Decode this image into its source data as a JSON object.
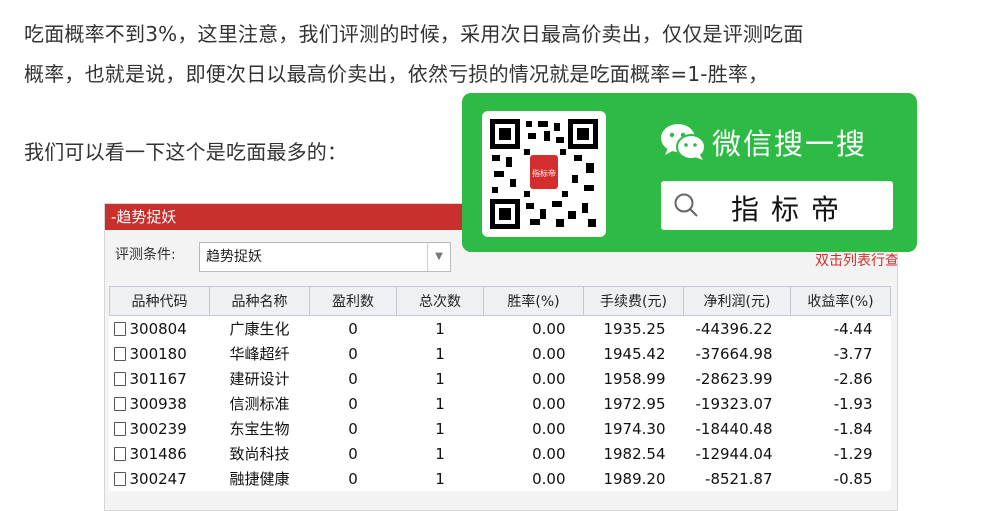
{
  "article": {
    "line1": "吃面概率不到3%，这里注意，我们评测的时候，采用次日最高价卖出，仅仅是评测吃面",
    "line2": "概率，也就是说，即便次日以最高价卖出，依然亏损的情况就是吃面概率=1-胜率，",
    "line3": "我们可以看一下这个是吃面最多的："
  },
  "window": {
    "title": "-趋势捉妖",
    "condition_label": "评测条件:",
    "condition_value": "趋势捉妖",
    "side_link": "双击列表行查"
  },
  "table": {
    "headers": [
      "品种代码",
      "品种名称",
      "盈利数",
      "总次数",
      "胜率(%)",
      "手续费(元)",
      "净利润(元)",
      "收益率(%)"
    ],
    "rows": [
      [
        "300804",
        "广康生化",
        "0",
        "1",
        "0.00",
        "1935.25",
        "-44396.22",
        "-4.44"
      ],
      [
        "300180",
        "华峰超纤",
        "0",
        "1",
        "0.00",
        "1945.42",
        "-37664.98",
        "-3.77"
      ],
      [
        "301167",
        "建研设计",
        "0",
        "1",
        "0.00",
        "1958.99",
        "-28623.99",
        "-2.86"
      ],
      [
        "300938",
        "信测标准",
        "0",
        "1",
        "0.00",
        "1972.95",
        "-19323.07",
        "-1.93"
      ],
      [
        "300239",
        "东宝生物",
        "0",
        "1",
        "0.00",
        "1974.30",
        "-18440.48",
        "-1.84"
      ],
      [
        "301486",
        "致尚科技",
        "0",
        "1",
        "0.00",
        "1982.54",
        "-12944.04",
        "-1.29"
      ],
      [
        "300247",
        "融捷健康",
        "0",
        "1",
        "0.00",
        "1989.20",
        "-8521.87",
        "-0.85"
      ]
    ]
  },
  "wechat": {
    "title": "微信搜一搜",
    "search_text": "指标帝",
    "qr_badge": "指标帝",
    "icons": [
      "wechat-icon",
      "search-icon",
      "qr-code"
    ],
    "brand_color": "#2dbb45"
  }
}
